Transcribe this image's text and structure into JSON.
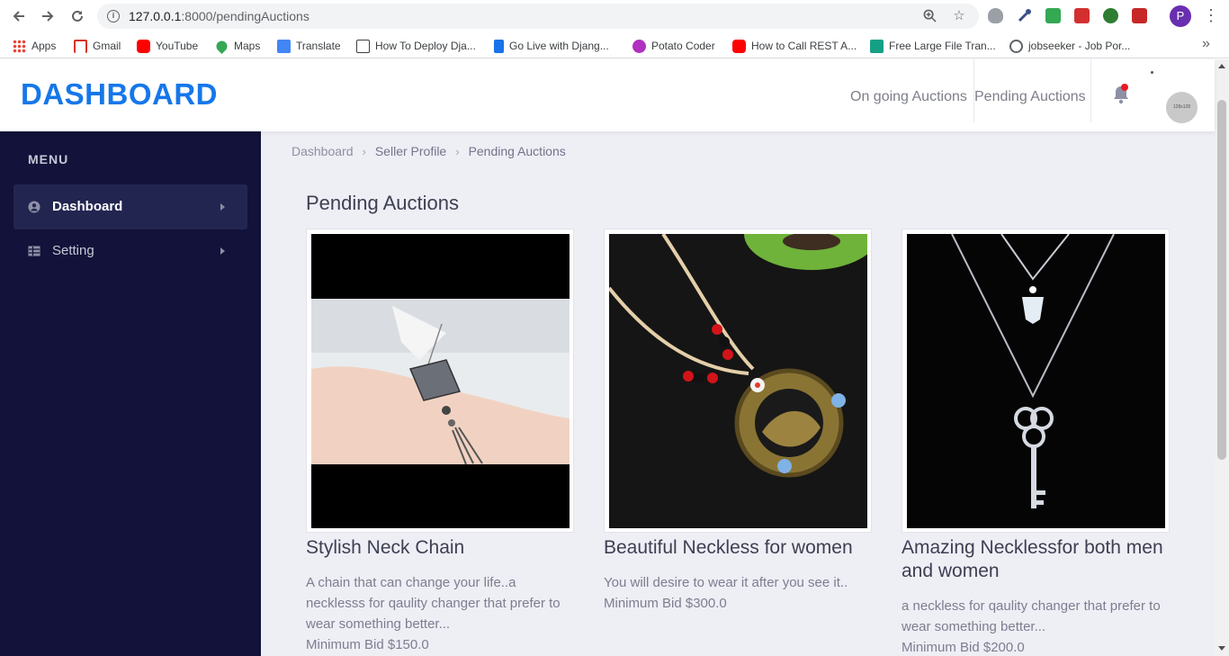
{
  "browser": {
    "url_host": "127.0.0.1",
    "url_path": ":8000/pendingAuctions",
    "profile_initial": "P",
    "bookmarks": [
      {
        "label": "Apps",
        "icon": "apps-grid-icon",
        "color": "#ea4335"
      },
      {
        "label": "Gmail",
        "icon": "gmail-icon",
        "color": "#d93025"
      },
      {
        "label": "YouTube",
        "icon": "youtube-icon",
        "color": "#ff0000"
      },
      {
        "label": "Maps",
        "icon": "maps-pin-icon",
        "color": "#34a853"
      },
      {
        "label": "Translate",
        "icon": "translate-icon",
        "color": "#4285f4"
      },
      {
        "label": "How To Deploy Dja...",
        "icon": "page-icon",
        "color": "#5f6368"
      },
      {
        "label": "Go Live with Djang...",
        "icon": "bookmark-icon",
        "color": "#1a73e8"
      },
      {
        "label": "Potato Coder",
        "icon": "potato-coder-icon",
        "color": "#b030c0"
      },
      {
        "label": "How to Call REST A...",
        "icon": "youtube-icon",
        "color": "#ff0000"
      },
      {
        "label": "Free Large File Tran...",
        "icon": "file-transfer-icon",
        "color": "#15a085"
      },
      {
        "label": "jobseeker - Job Por...",
        "icon": "globe-icon",
        "color": "#5f6368"
      }
    ]
  },
  "header": {
    "brand": "DASHBOARD",
    "links": [
      "On going Auctions",
      "Pending Auctions"
    ],
    "profile_image_alt": "128x128"
  },
  "sidebar": {
    "menu_label": "MENU",
    "items": [
      {
        "label": "Dashboard",
        "icon": "user-circle-icon",
        "active": true
      },
      {
        "label": "Setting",
        "icon": "table-icon",
        "active": false
      }
    ]
  },
  "breadcrumb": [
    "Dashboard",
    "Seller Profile",
    "Pending Auctions"
  ],
  "main": {
    "title": "Pending Auctions",
    "cards": [
      {
        "name": "Stylish Neck Chain",
        "description": "A chain that can change your life..a necklesss for qaulity changer that prefer to wear something better...",
        "min_bid": "Minimum Bid $150.0"
      },
      {
        "name": "Beautiful Neckless for women",
        "description": "You will desire to wear it after you see it..",
        "min_bid": "Minimum Bid $300.0"
      },
      {
        "name": "Amazing Necklessfor both men and women",
        "description": "a neckless for qaulity changer that prefer to wear something better...",
        "min_bid": "Minimum Bid $200.0"
      }
    ]
  }
}
